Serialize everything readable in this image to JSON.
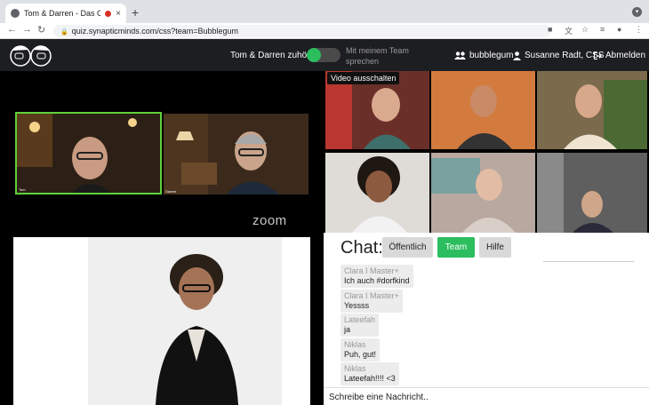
{
  "browser": {
    "tab_title": "Tom & Darren - Das Online",
    "tab_close": "×",
    "new_tab": "+",
    "url": "quiz.synapticminds.com/css?team=Bubblegum",
    "back": "←",
    "forward": "→",
    "reload": "↻"
  },
  "header": {
    "listen_label": "Tom & Darren zuhören",
    "team_speak_label": "Mit meinem Team sprechen",
    "team_name": "bubblegum",
    "user_name": "Susanne Radt, CSS",
    "logout_label": "Abmelden",
    "toggle_on": true,
    "accent_color": "#2bbd5e"
  },
  "videos": {
    "host_tiles": [
      {
        "name": "Tom"
      },
      {
        "name": "Darren"
      }
    ],
    "zoom_logo": "zoom",
    "video_off_label": "Video ausschalten"
  },
  "chat": {
    "title": "Chat:",
    "tabs": [
      {
        "label": "Öffentlich",
        "active": false
      },
      {
        "label": "Team",
        "active": true
      },
      {
        "label": "Hilfe",
        "active": false
      }
    ],
    "messages": [
      {
        "author": "Clara I Master+",
        "text": "Ich auch #dorfkind"
      },
      {
        "author": "Clara I Master+",
        "text": "Yessss"
      },
      {
        "author": "Lateefah",
        "text": "ja"
      },
      {
        "author": "Niklas",
        "text": "Puh, gut!"
      },
      {
        "author": "Niklas",
        "text": "Lateefah!!!! <3"
      }
    ],
    "input_placeholder": "Schreibe eine Nachricht.."
  }
}
